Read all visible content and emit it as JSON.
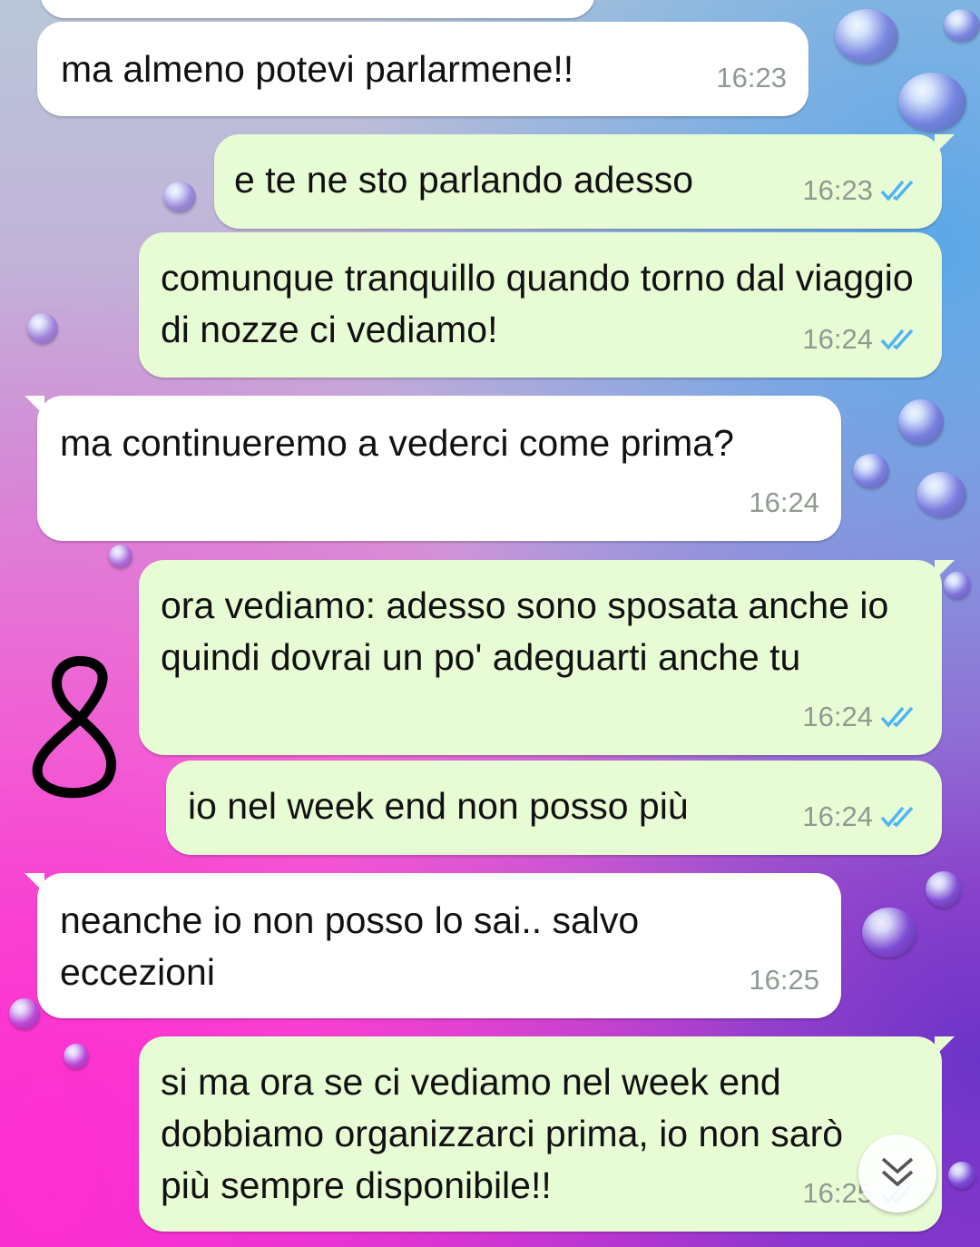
{
  "messages": [
    {
      "text": "",
      "time": ""
    },
    {
      "text": "ma almeno potevi parlarmene!!",
      "time": "16:23"
    },
    {
      "text": "e te ne sto parlando adesso",
      "time": "16:23"
    },
    {
      "text": "comunque tranquillo quando torno dal viaggio di nozze ci vediamo!",
      "time": "16:24"
    },
    {
      "text": "ma continueremo a vederci come prima?",
      "time": "16:24"
    },
    {
      "text": "ora vediamo: adesso sono sposata anche io quindi dovrai un po' adeguarti anche tu",
      "time": "16:24"
    },
    {
      "text": "io nel week end non posso più",
      "time": "16:24"
    },
    {
      "text": "neanche io non posso lo sai.. salvo eccezioni",
      "time": "16:25"
    },
    {
      "text": "si ma ora se ci vediamo nel week end dobbiamo organizzarci prima, io non sarò più sempre disponibile!!",
      "time": "16:25"
    }
  ],
  "colors": {
    "incoming_bubble": "#ffffff",
    "outgoing_bubble": "#e7fcd4",
    "read_ticks": "#4fb3f6",
    "timestamp": "#8f9a90"
  },
  "icons": {
    "read_receipt": "double-check-icon",
    "scroll_down": "chevron-double-down-icon",
    "doodle": "hand-drawn-eight"
  }
}
